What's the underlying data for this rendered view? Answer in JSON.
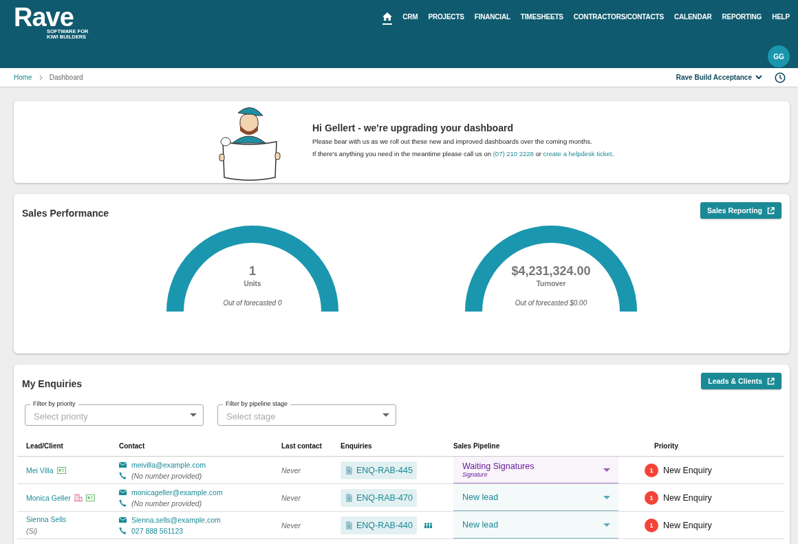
{
  "header": {
    "logo": "Rave",
    "tagline": [
      "SOFTWARE FOR",
      "KIWI BUILDERS"
    ],
    "nav": [
      {
        "kind": "home",
        "selected": true
      },
      {
        "kind": "text",
        "label": "CRM",
        "selected": false
      },
      {
        "kind": "text",
        "label": "PROJECTS",
        "selected": false
      },
      {
        "kind": "text",
        "label": "FINANCIAL",
        "selected": false
      },
      {
        "kind": "text",
        "label": "TIMESHEETS",
        "selected": false
      },
      {
        "kind": "text",
        "label": "CONTRACTORS/CONTACTS",
        "selected": false
      },
      {
        "kind": "text",
        "label": "CALENDAR",
        "selected": false
      },
      {
        "kind": "text",
        "label": "REPORTING",
        "selected": false
      },
      {
        "kind": "text",
        "label": "HELP",
        "selected": false
      }
    ],
    "avatar": "GG"
  },
  "breadcrumb": [
    "Home",
    "Dashboard"
  ],
  "company_selector": "Rave Build Acceptance",
  "banner": {
    "title": "Hi Gellert - we're upgrading your dashboard",
    "line_1": "Please bear with us as we roll out these new and improved dashboards over the coming months.",
    "line_2_start": "If there's anything you need in the meantime please call us on",
    "phone": "(07) 210 2228",
    "line_2_mid": "or",
    "link": "create a helpdesk ticket",
    "line_2_end": "."
  },
  "sales_performance": {
    "title": "Sales Performance",
    "button": "Sales Reporting",
    "gauges": [
      {
        "value": "1",
        "label": "Units",
        "forecast": "Out of forecasted 0",
        "level": 1
      },
      {
        "value": "$4,231,324.00",
        "label": "Turnover",
        "forecast": "Out of forecasted $0.00",
        "level": 1
      }
    ]
  },
  "enquiries": {
    "title": "My Enquiries",
    "button": "Leads & Clients",
    "filters": [
      {
        "label": "Filter by priority",
        "placeholder": "Select priority"
      },
      {
        "label": "Filter by pipeline stage",
        "placeholder": "Select stage"
      }
    ],
    "columns": [
      "Lead/Client",
      "Contact",
      "Last contact",
      "Enquiries",
      "Sales Pipeline",
      "Priority"
    ],
    "rows": [
      {
        "name": "Mei Villa",
        "alias": null,
        "badges": [
          {
            "kind": "contact"
          }
        ],
        "email": "meivilla@example.com",
        "phone": "(No number provided)",
        "phone_missing": true,
        "last_contact": "Never",
        "enquiry": "ENQ-RAB-445",
        "group": false,
        "stage": "Waiting Signatures",
        "substage": "Signature",
        "color": "#6a1b9a",
        "priority_count": "1",
        "priority": "New Enquiry"
      },
      {
        "name": "Monica Geller",
        "alias": null,
        "badges": [
          {
            "kind": "company"
          },
          {
            "kind": "contact"
          }
        ],
        "email": "monicageller@example.com",
        "phone": "(No number provided)",
        "phone_missing": true,
        "last_contact": "Never",
        "enquiry": "ENQ-RAB-470",
        "group": false,
        "stage": "New lead",
        "substage": null,
        "color": "#1a8a96",
        "priority_count": "1",
        "priority": "New Enquiry"
      },
      {
        "name": "Sienna Sells",
        "alias": "(Si)",
        "badges": [],
        "email": "Sienna.sells@example.com",
        "phone": "027 888 561123",
        "phone_missing": false,
        "last_contact": "Never",
        "enquiry": "ENQ-RAB-440",
        "group": true,
        "stage": "New lead",
        "substage": null,
        "color": "#1a8a96",
        "priority_count": "1",
        "priority": "New Enquiry"
      }
    ]
  }
}
